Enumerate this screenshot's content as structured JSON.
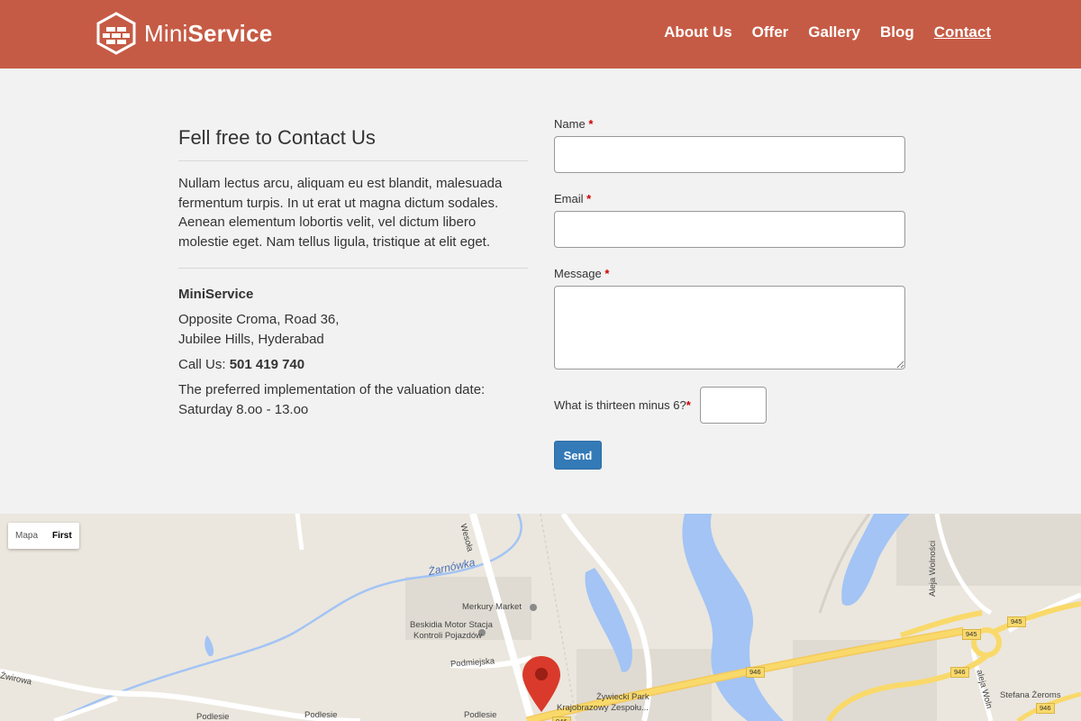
{
  "header": {
    "brand_light": "Mini",
    "brand_bold": "Service",
    "nav": [
      {
        "label": "About Us"
      },
      {
        "label": "Offer"
      },
      {
        "label": "Gallery"
      },
      {
        "label": "Blog"
      },
      {
        "label": "Contact",
        "active": true
      }
    ]
  },
  "contact": {
    "title": "Fell free to Contact Us",
    "intro": "Nullam lectus arcu, aliquam eu est blandit, malesuada fermentum turpis. In ut erat ut magna dictum sodales. Aenean elementum lobortis velit, vel dictum libero molestie eget. Nam tellus ligula, tristique at elit eget.",
    "company": "MiniService",
    "address_line1": "Opposite Croma, Road 36,",
    "address_line2": "Jubilee Hills, Hyderabad",
    "call_label": "Call Us:",
    "phone": "501 419 740",
    "hours_line1": "The preferred implementation of the valuation date:",
    "hours_line2": "Saturday 8.oo - 13.oo"
  },
  "form": {
    "name_label": "Name",
    "email_label": "Email",
    "message_label": "Message",
    "captcha_label": "What is thirteen minus 6?",
    "required_mark": "*",
    "name_value": "",
    "email_value": "",
    "message_value": "",
    "captcha_value": "",
    "send_label": "Send"
  },
  "map": {
    "toggle": {
      "option1": "Mapa",
      "option2": "First"
    },
    "labels": {
      "river": "Żarnówka",
      "wesola": "Wesoła",
      "merkury": "Merkury Market",
      "beskidia1": "Beskidia Motor Stacja",
      "beskidia2": "Kontroli Pojazdów",
      "podmiejska": "Podmiejska",
      "zwirowa": "Żwirowa",
      "podlesie1": "Podlesie",
      "podlesie2": "Podlesie",
      "podlesie3": "Podlesie",
      "park1": "Żywiecki Park",
      "park2": "Krajobrazowy Zespołu...",
      "aleja_wolnosci": "Aleja Wolności",
      "aleja_woln2": "aleja Woln",
      "zeroms": "Stefana Żeroms"
    },
    "shields": {
      "s945a": "945",
      "s945b": "945",
      "s946a": "946",
      "s946b": "946",
      "s946c": "946",
      "s946d": "946"
    },
    "colors": {
      "land": "#ebe7de",
      "water": "#a3c4f5",
      "road_major": "#f9d96a",
      "road": "#ffffff",
      "pin": "#d93a2b"
    }
  }
}
